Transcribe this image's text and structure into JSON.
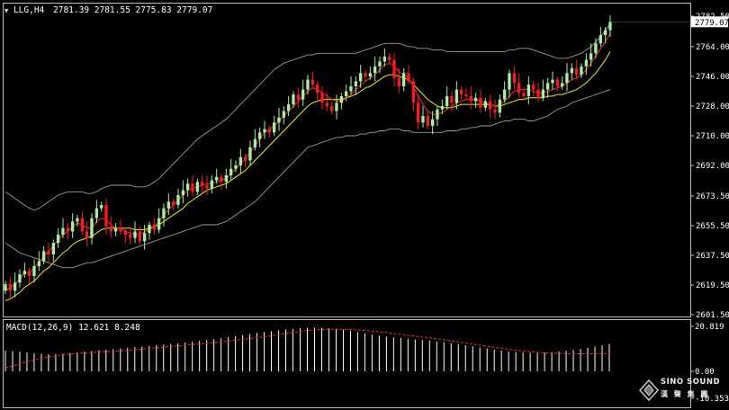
{
  "header": {
    "symbol": "LLG,H4",
    "ohlc": "2781.39 2781.55 2775.83 2779.07"
  },
  "macd_panel": {
    "label": "MACD(12,26,9) 12.621 8.248",
    "top_tick": "20.819",
    "zero_tick": "0.00",
    "bottom_tick": "-10.353"
  },
  "logo": {
    "line1": "SINO SOUND",
    "line2": "漢 聲 集 團"
  },
  "colors": {
    "background": "#000000",
    "bull_candle": "#a8f0a0",
    "bear_candle": "#ff1a1a",
    "fast_ma": "#ff2a2a",
    "slow_ma": "#f0f000",
    "bollinger": "#9a9a9a",
    "macd_histogram": "#ffffff",
    "macd_signal": "#ff2a2a",
    "current_price_box": "#ffffff"
  },
  "chart_data": [
    {
      "type": "candlestick",
      "symbol": "LLG",
      "timeframe": "H4",
      "current_price": 2779.07,
      "y_ticks": [
        "2782.50",
        "2764.00",
        "2746.00",
        "2728.00",
        "2710.00",
        "2692.00",
        "2673.50",
        "2655.50",
        "2637.50",
        "2619.50",
        "2601.50"
      ],
      "ylim": [
        2601.5,
        2782.5
      ],
      "indicators": [
        "Bollinger Bands",
        "Moving Average (fast)",
        "Moving Average (slow)"
      ],
      "grid": false,
      "close": [
        2620,
        2616,
        2621,
        2626,
        2628,
        2625,
        2631,
        2634,
        2640,
        2638,
        2645,
        2650,
        2654,
        2652,
        2658,
        2660,
        2652,
        2648,
        2660,
        2666,
        2668,
        2655,
        2652,
        2654,
        2652,
        2650,
        2648,
        2652,
        2646,
        2651,
        2656,
        2653,
        2660,
        2666,
        2670,
        2668,
        2674,
        2677,
        2681,
        2676,
        2682,
        2680,
        2678,
        2683,
        2685,
        2682,
        2686,
        2690,
        2692,
        2697,
        2695,
        2703,
        2708,
        2712,
        2714,
        2712,
        2718,
        2721,
        2725,
        2729,
        2735,
        2732,
        2738,
        2744,
        2741,
        2736,
        2730,
        2728,
        2725,
        2730,
        2734,
        2737,
        2740,
        2743,
        2748,
        2746,
        2748,
        2752,
        2755,
        2758,
        2756,
        2745,
        2740,
        2748,
        2743,
        2730,
        2718,
        2722,
        2716,
        2720,
        2726,
        2728,
        2734,
        2730,
        2738,
        2735,
        2734,
        2731,
        2733,
        2727,
        2731,
        2726,
        2724,
        2732,
        2738,
        2748,
        2742,
        2736,
        2734,
        2741,
        2738,
        2733,
        2738,
        2742,
        2744,
        2740,
        2742,
        2748,
        2751,
        2747,
        2752,
        2756,
        2760,
        2766,
        2771,
        2774,
        2779
      ],
      "fast_ma": [
        2616,
        2618,
        2620,
        2623,
        2627,
        2627,
        2630,
        2633,
        2637,
        2640,
        2643,
        2647,
        2650,
        2652,
        2655,
        2657,
        2656,
        2654,
        2654,
        2658,
        2660,
        2659,
        2656,
        2654,
        2654,
        2652,
        2651,
        2650,
        2650,
        2652,
        2653,
        2655,
        2658,
        2662,
        2665,
        2668,
        2671,
        2674,
        2677,
        2678,
        2679,
        2680,
        2681,
        2681,
        2682,
        2683,
        2684,
        2687,
        2690,
        2693,
        2696,
        2700,
        2704,
        2708,
        2712,
        2714,
        2716,
        2719,
        2722,
        2725,
        2728,
        2731,
        2734,
        2737,
        2739,
        2738,
        2736,
        2734,
        2732,
        2731,
        2731,
        2733,
        2735,
        2738,
        2741,
        2743,
        2745,
        2747,
        2750,
        2753,
        2754,
        2752,
        2749,
        2747,
        2745,
        2740,
        2734,
        2729,
        2725,
        2723,
        2723,
        2724,
        2726,
        2728,
        2730,
        2731,
        2732,
        2732,
        2732,
        2731,
        2730,
        2729,
        2728,
        2729,
        2731,
        2734,
        2737,
        2738,
        2738,
        2738,
        2737,
        2736,
        2736,
        2737,
        2738,
        2739,
        2740,
        2742,
        2744,
        2745,
        2747,
        2750,
        2754,
        2758,
        2763,
        2767,
        2772
      ],
      "slow_ma": [
        2610,
        2611,
        2613,
        2615,
        2618,
        2620,
        2622,
        2625,
        2628,
        2630,
        2633,
        2636,
        2639,
        2641,
        2644,
        2646,
        2647,
        2648,
        2649,
        2651,
        2653,
        2654,
        2654,
        2654,
        2654,
        2654,
        2654,
        2653,
        2653,
        2653,
        2654,
        2655,
        2656,
        2658,
        2660,
        2662,
        2664,
        2666,
        2669,
        2671,
        2673,
        2675,
        2677,
        2678,
        2679,
        2680,
        2681,
        2683,
        2685,
        2687,
        2689,
        2692,
        2695,
        2698,
        2701,
        2704,
        2707,
        2710,
        2713,
        2716,
        2719,
        2722,
        2725,
        2728,
        2730,
        2731,
        2732,
        2732,
        2732,
        2732,
        2732,
        2733,
        2734,
        2735,
        2737,
        2739,
        2740,
        2742,
        2744,
        2746,
        2747,
        2747,
        2746,
        2745,
        2744,
        2741,
        2738,
        2735,
        2732,
        2730,
        2728,
        2727,
        2727,
        2727,
        2728,
        2729,
        2729,
        2729,
        2729,
        2729,
        2729,
        2729,
        2728,
        2728,
        2729,
        2730,
        2731,
        2732,
        2732,
        2733,
        2733,
        2733,
        2733,
        2734,
        2734,
        2735,
        2735,
        2736,
        2737,
        2738,
        2740,
        2742,
        2745,
        2748,
        2752,
        2756,
        2761
      ],
      "upper_band": [
        2676,
        2674,
        2672,
        2670,
        2668,
        2666,
        2665,
        2666,
        2668,
        2670,
        2672,
        2674,
        2675,
        2676,
        2676,
        2676,
        2676,
        2675,
        2675,
        2676,
        2678,
        2679,
        2680,
        2680,
        2680,
        2680,
        2680,
        2679,
        2679,
        2679,
        2680,
        2682,
        2684,
        2687,
        2690,
        2693,
        2696,
        2699,
        2702,
        2705,
        2708,
        2710,
        2712,
        2714,
        2716,
        2718,
        2720,
        2723,
        2726,
        2729,
        2732,
        2735,
        2738,
        2741,
        2744,
        2747,
        2750,
        2752,
        2754,
        2755,
        2756,
        2757,
        2758,
        2759,
        2759,
        2760,
        2760,
        2760,
        2760,
        2760,
        2760,
        2760,
        2760,
        2760,
        2761,
        2762,
        2763,
        2764,
        2765,
        2766,
        2766,
        2766,
        2766,
        2765,
        2764,
        2764,
        2763,
        2763,
        2763,
        2762,
        2762,
        2762,
        2761,
        2761,
        2761,
        2761,
        2761,
        2761,
        2761,
        2761,
        2761,
        2761,
        2761,
        2761,
        2761,
        2762,
        2762,
        2763,
        2763,
        2763,
        2762,
        2761,
        2760,
        2759,
        2758,
        2757,
        2757,
        2757,
        2758,
        2759,
        2760,
        2762,
        2764,
        2767,
        2770,
        2774,
        2778
      ],
      "lower_band": [
        2645,
        2643,
        2641,
        2639,
        2638,
        2637,
        2636,
        2635,
        2634,
        2633,
        2632,
        2631,
        2630,
        2630,
        2630,
        2631,
        2632,
        2633,
        2633,
        2634,
        2635,
        2636,
        2637,
        2638,
        2639,
        2640,
        2641,
        2642,
        2643,
        2644,
        2645,
        2646,
        2647,
        2648,
        2649,
        2650,
        2651,
        2652,
        2653,
        2654,
        2655,
        2656,
        2656,
        2656,
        2656,
        2657,
        2658,
        2660,
        2662,
        2664,
        2666,
        2668,
        2670,
        2673,
        2676,
        2679,
        2682,
        2685,
        2688,
        2691,
        2694,
        2697,
        2700,
        2703,
        2704,
        2705,
        2706,
        2707,
        2708,
        2709,
        2709,
        2710,
        2710,
        2710,
        2711,
        2711,
        2712,
        2712,
        2713,
        2713,
        2714,
        2714,
        2714,
        2713,
        2713,
        2712,
        2712,
        2712,
        2712,
        2712,
        2712,
        2712,
        2713,
        2713,
        2713,
        2714,
        2714,
        2715,
        2715,
        2716,
        2716,
        2716,
        2717,
        2718,
        2719,
        2719,
        2720,
        2720,
        2720,
        2719,
        2719,
        2720,
        2721,
        2722,
        2724,
        2726,
        2727,
        2728,
        2730,
        2731,
        2732,
        2733,
        2734,
        2735,
        2736,
        2737,
        2738
      ]
    },
    {
      "type": "bar",
      "title": "MACD(12,26,9)",
      "macd": 12.621,
      "signal": 8.248,
      "ylim": [
        -10.353,
        20.819
      ],
      "y_ticks": [
        "20.819",
        "0.00",
        "-10.353"
      ],
      "histogram": [
        9.6,
        9.4,
        9.1,
        8.7,
        8.4,
        8.1,
        7.9,
        8.0,
        8.2,
        8.5,
        8.8,
        9.1,
        9.4,
        9.7,
        10.0,
        10.3,
        10.6,
        10.9,
        11.2,
        11.5,
        11.8,
        12.1,
        12.4,
        12.7,
        13.0,
        13.3,
        13.7,
        14.1,
        14.5,
        14.9,
        15.3,
        15.8,
        16.3,
        16.8,
        17.3,
        17.8,
        18.2,
        18.6,
        19.0,
        19.4,
        19.7,
        20.0,
        20.2,
        20.3,
        20.2,
        20.0,
        19.7,
        19.3,
        18.8,
        18.2,
        17.6,
        17.0,
        16.5,
        16.1,
        15.7,
        15.4,
        15.1,
        14.8,
        14.5,
        14.2,
        13.9,
        13.5,
        13.1,
        12.6,
        12.1,
        11.6,
        11.1,
        10.6,
        10.1,
        9.6,
        9.2,
        8.9,
        8.7,
        8.6,
        8.6,
        8.7,
        8.9,
        9.2,
        9.5,
        9.9,
        10.4,
        10.9,
        11.4,
        12.0,
        12.6
      ],
      "signal_line": [
        1.5,
        2.5,
        3.5,
        4.5,
        5.3,
        6.0,
        6.6,
        7.2,
        7.6,
        8.0,
        8.3,
        8.5,
        8.7,
        8.9,
        9.1,
        9.3,
        9.5,
        9.7,
        10.0,
        10.3,
        10.6,
        10.9,
        11.2,
        11.5,
        11.8,
        12.1,
        12.4,
        12.7,
        13.0,
        13.3,
        13.6,
        14.0,
        14.4,
        14.8,
        15.2,
        15.6,
        16.0,
        16.5,
        17.0,
        17.5,
        18.0,
        18.5,
        18.9,
        19.2,
        19.4,
        19.5,
        19.5,
        19.4,
        19.3,
        19.1,
        18.9,
        18.6,
        18.3,
        17.9,
        17.5,
        17.1,
        16.7,
        16.3,
        15.9,
        15.5,
        15.1,
        14.6,
        14.1,
        13.6,
        13.1,
        12.6,
        12.1,
        11.6,
        11.1,
        10.6,
        10.2,
        9.8,
        9.4,
        9.1,
        8.8,
        8.6,
        8.4,
        8.3,
        8.2,
        8.1,
        8.1,
        8.1,
        8.1,
        8.2,
        8.25
      ]
    }
  ]
}
